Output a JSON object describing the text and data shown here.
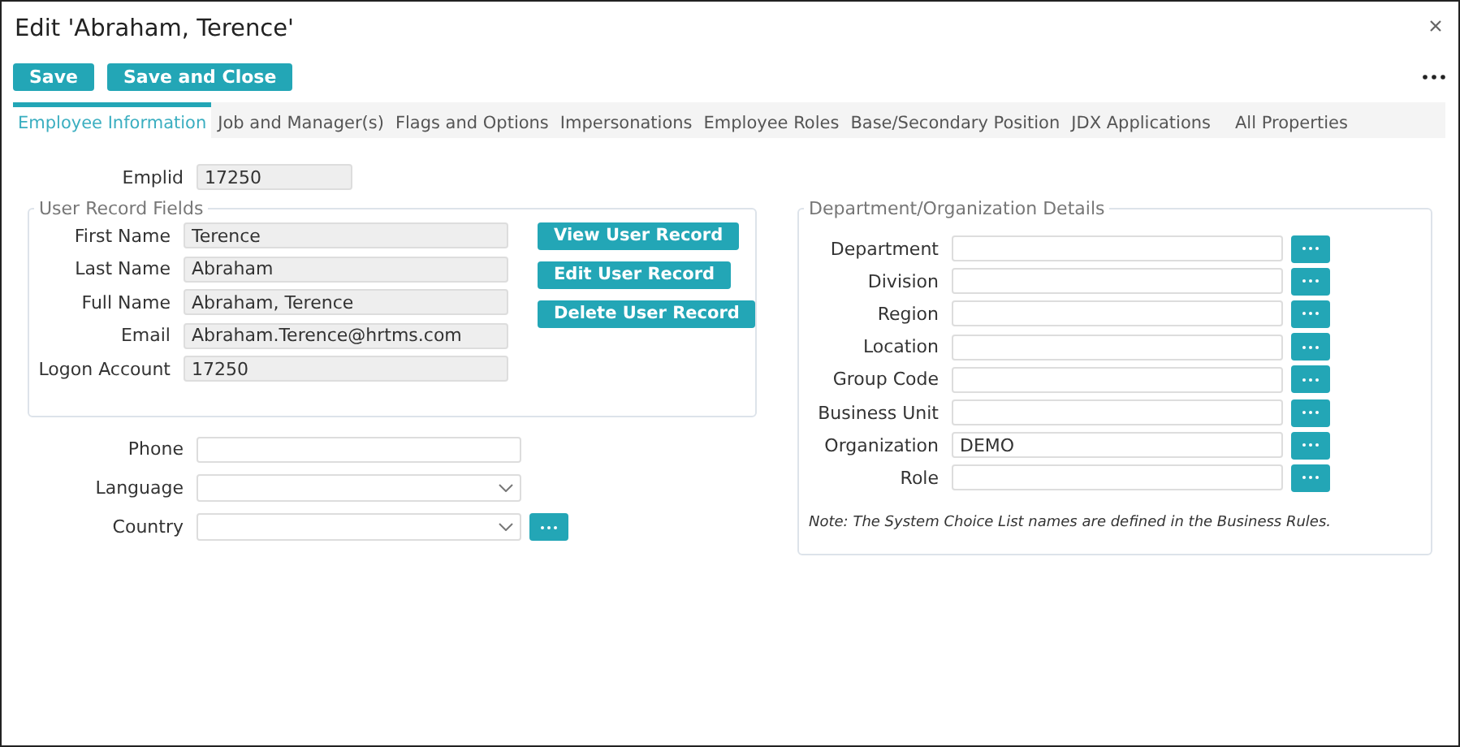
{
  "window": {
    "title": "Edit 'Abraham, Terence'"
  },
  "toolbar": {
    "buttons": [
      "Save",
      "Save and Close"
    ]
  },
  "tabs": [
    {
      "label": "Employee Information",
      "selected": true
    },
    {
      "label": "Job and Manager(s)",
      "selected": false
    },
    {
      "label": "Flags and Options",
      "selected": false
    },
    {
      "label": "Impersonations",
      "selected": false
    },
    {
      "label": "Employee Roles",
      "selected": false
    },
    {
      "label": "Base/Secondary Position",
      "selected": false
    },
    {
      "label": "JDX Applications",
      "selected": false
    },
    {
      "label": "All Properties",
      "selected": false
    }
  ],
  "emplid": {
    "label": "Emplid",
    "value": "17250",
    "disabled": true
  },
  "user_record": {
    "title": "User Record Fields",
    "fields": [
      {
        "label": "First Name",
        "value": "Terence",
        "disabled": true
      },
      {
        "label": "Last Name",
        "value": "Abraham",
        "disabled": true
      },
      {
        "label": "Full Name",
        "value": "Abraham, Terence",
        "disabled": true
      },
      {
        "label": "Email",
        "value": "Abraham.Terence@hrtms.com",
        "disabled": true
      },
      {
        "label": "Logon Account",
        "value": "17250",
        "disabled": true
      }
    ],
    "buttons": [
      "View User Record",
      "Edit User Record",
      "Delete User Record"
    ]
  },
  "contact_fields": [
    {
      "label": "Phone",
      "kind": "text"
    },
    {
      "label": "Language",
      "kind": "select"
    },
    {
      "label": "Country",
      "kind": "select_lookup"
    }
  ],
  "department": {
    "title": "Department/Organization Details",
    "fields": [
      {
        "label": "Department"
      },
      {
        "label": "Division"
      },
      {
        "label": "Region"
      },
      {
        "label": "Location"
      },
      {
        "label": "Group Code"
      },
      {
        "label": "Business Unit"
      },
      {
        "label": "Organization",
        "value": "DEMO"
      },
      {
        "label": "Role"
      }
    ],
    "note": "Note: The System Choice List names are defined in the Business Rules."
  }
}
